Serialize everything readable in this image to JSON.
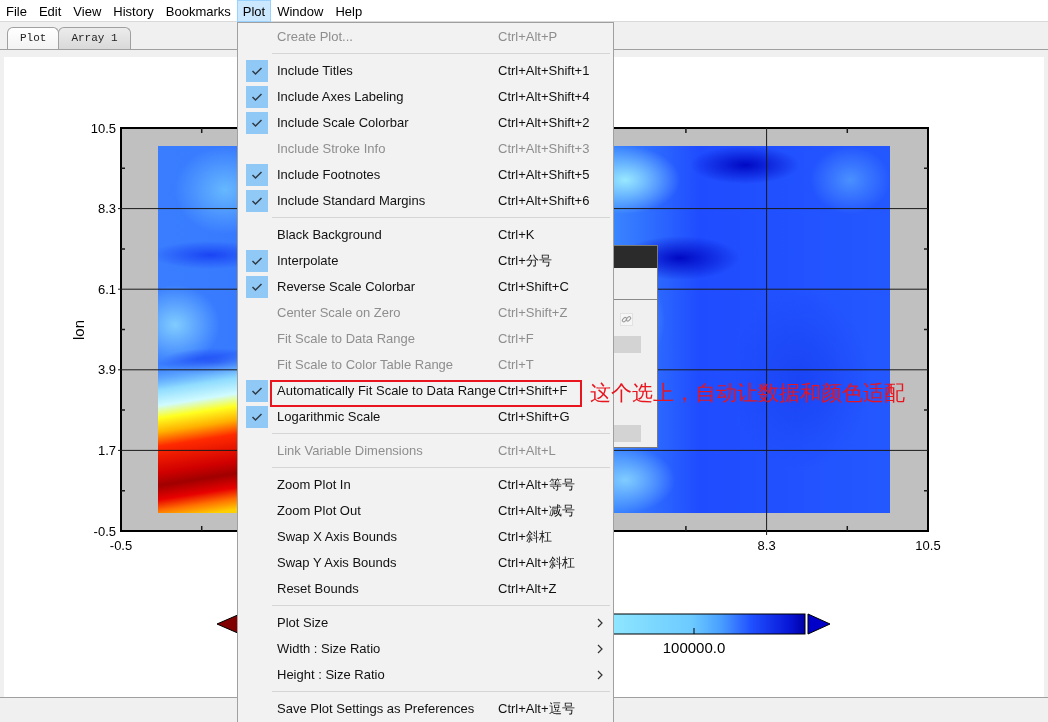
{
  "menubar": [
    {
      "label": "File",
      "selected": false
    },
    {
      "label": "Edit",
      "selected": false
    },
    {
      "label": "View",
      "selected": false
    },
    {
      "label": "History",
      "selected": false
    },
    {
      "label": "Bookmarks",
      "selected": false
    },
    {
      "label": "Plot",
      "selected": true
    },
    {
      "label": "Window",
      "selected": false
    },
    {
      "label": "Help",
      "selected": false
    }
  ],
  "tabs": [
    {
      "label": "Plot",
      "selected": true
    },
    {
      "label": "Array 1",
      "selected": false
    }
  ],
  "plot": {
    "ylabel": "lon",
    "yticks": [
      "10.5",
      "8.3",
      "6.1",
      "3.9",
      "1.7",
      "-0.5"
    ],
    "xticks": [
      "-0.5",
      "8.3",
      "10.5"
    ],
    "colorbar": {
      "labels": [
        "100000.0"
      ]
    }
  },
  "menu": {
    "groups": [
      {
        "items": [
          {
            "kind": "command",
            "label": "Create Plot...",
            "shortcut": "Ctrl+Alt+P",
            "checked": false,
            "disabled": true
          }
        ]
      },
      {
        "items": [
          {
            "kind": "command",
            "label": "Include Titles",
            "shortcut": "Ctrl+Alt+Shift+1",
            "checked": true,
            "disabled": false
          },
          {
            "kind": "command",
            "label": "Include Axes Labeling",
            "shortcut": "Ctrl+Alt+Shift+4",
            "checked": true,
            "disabled": false
          },
          {
            "kind": "command",
            "label": "Include Scale Colorbar",
            "shortcut": "Ctrl+Alt+Shift+2",
            "checked": true,
            "disabled": false
          },
          {
            "kind": "command",
            "label": "Include Stroke Info",
            "shortcut": "Ctrl+Alt+Shift+3",
            "checked": false,
            "disabled": true
          },
          {
            "kind": "command",
            "label": "Include Footnotes",
            "shortcut": "Ctrl+Alt+Shift+5",
            "checked": true,
            "disabled": false
          },
          {
            "kind": "command",
            "label": "Include Standard Margins",
            "shortcut": "Ctrl+Alt+Shift+6",
            "checked": true,
            "disabled": false
          }
        ]
      },
      {
        "items": [
          {
            "kind": "command",
            "label": "Black Background",
            "shortcut": "Ctrl+K",
            "checked": false,
            "disabled": false
          },
          {
            "kind": "command",
            "label": "Interpolate",
            "shortcut": "Ctrl+分号",
            "checked": true,
            "disabled": false
          },
          {
            "kind": "command",
            "label": "Reverse Scale Colorbar",
            "shortcut": "Ctrl+Shift+C",
            "checked": true,
            "disabled": false
          },
          {
            "kind": "command",
            "label": "Center Scale on Zero",
            "shortcut": "Ctrl+Shift+Z",
            "checked": false,
            "disabled": true
          },
          {
            "kind": "command",
            "label": "Fit Scale to Data Range",
            "shortcut": "Ctrl+F",
            "checked": false,
            "disabled": true
          },
          {
            "kind": "command",
            "label": "Fit Scale to Color Table Range",
            "shortcut": "Ctrl+T",
            "checked": false,
            "disabled": true
          },
          {
            "kind": "command",
            "label": "Automatically Fit Scale to Data Range",
            "shortcut": "Ctrl+Shift+F",
            "checked": true,
            "disabled": false,
            "note": "这个选上，自动让数据和颜色适配"
          },
          {
            "kind": "command",
            "label": "Logarithmic Scale",
            "shortcut": "Ctrl+Shift+G",
            "checked": true,
            "disabled": false
          }
        ]
      },
      {
        "items": [
          {
            "kind": "command",
            "label": "Link Variable Dimensions",
            "shortcut": "Ctrl+Alt+L",
            "checked": false,
            "disabled": true
          }
        ]
      },
      {
        "items": [
          {
            "kind": "command",
            "label": "Zoom Plot In",
            "shortcut": "Ctrl+Alt+等号",
            "checked": false,
            "disabled": false
          },
          {
            "kind": "command",
            "label": "Zoom Plot Out",
            "shortcut": "Ctrl+Alt+减号",
            "checked": false,
            "disabled": false
          },
          {
            "kind": "command",
            "label": "Swap X Axis Bounds",
            "shortcut": "Ctrl+斜杠",
            "checked": false,
            "disabled": false
          },
          {
            "kind": "command",
            "label": "Swap Y Axis Bounds",
            "shortcut": "Ctrl+Alt+斜杠",
            "checked": false,
            "disabled": false
          },
          {
            "kind": "command",
            "label": "Reset Bounds",
            "shortcut": "Ctrl+Alt+Z",
            "checked": false,
            "disabled": false
          }
        ]
      },
      {
        "items": [
          {
            "kind": "submenu",
            "label": "Plot Size",
            "checked": false,
            "disabled": false
          },
          {
            "kind": "submenu",
            "label": "Width : Size Ratio",
            "checked": false,
            "disabled": false
          },
          {
            "kind": "submenu",
            "label": "Height : Size Ratio",
            "checked": false,
            "disabled": false
          }
        ]
      },
      {
        "items": [
          {
            "kind": "command",
            "label": "Save Plot Settings as Preferences",
            "shortcut": "Ctrl+Alt+逗号",
            "checked": false,
            "disabled": false
          }
        ]
      }
    ]
  }
}
